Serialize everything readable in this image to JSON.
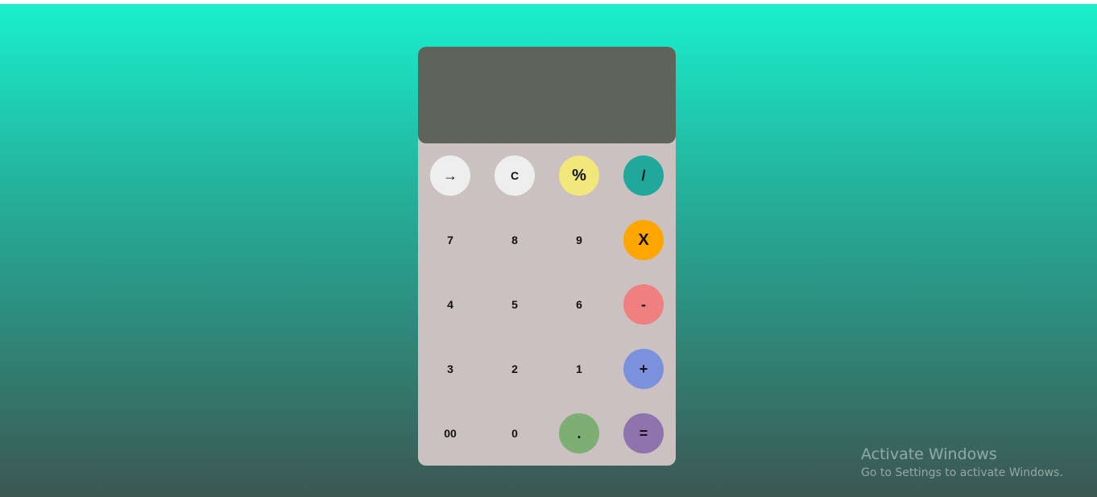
{
  "calculator": {
    "display_value": "",
    "colors": {
      "body": "#cbc1c1",
      "display": "#5e645c",
      "background_top": "#19f0cc",
      "background_bottom": "#3c5752"
    },
    "buttons": [
      {
        "label": "→",
        "name": "backspace-button",
        "color": "#eeeeee"
      },
      {
        "label": "C",
        "name": "clear-button",
        "color": "#eeeeee"
      },
      {
        "label": "%",
        "name": "percent-button",
        "color": "#f1e77b"
      },
      {
        "label": "/",
        "name": "divide-button",
        "color": "#20a89a"
      },
      {
        "label": "7",
        "name": "digit-7-button",
        "color": ""
      },
      {
        "label": "8",
        "name": "digit-8-button",
        "color": ""
      },
      {
        "label": "9",
        "name": "digit-9-button",
        "color": ""
      },
      {
        "label": "X",
        "name": "multiply-button",
        "color": "#ffa500"
      },
      {
        "label": "4",
        "name": "digit-4-button",
        "color": ""
      },
      {
        "label": "5",
        "name": "digit-5-button",
        "color": ""
      },
      {
        "label": "6",
        "name": "digit-6-button",
        "color": ""
      },
      {
        "label": "-",
        "name": "subtract-button",
        "color": "#f08080"
      },
      {
        "label": "3",
        "name": "digit-3-button",
        "color": ""
      },
      {
        "label": "2",
        "name": "digit-2-button",
        "color": ""
      },
      {
        "label": "1",
        "name": "digit-1-button",
        "color": ""
      },
      {
        "label": "+",
        "name": "add-button",
        "color": "#7b91de"
      },
      {
        "label": "00",
        "name": "double-zero-button",
        "color": ""
      },
      {
        "label": "0",
        "name": "digit-0-button",
        "color": ""
      },
      {
        "label": ".",
        "name": "decimal-button",
        "color": "#7dae74"
      },
      {
        "label": "=",
        "name": "equals-button",
        "color": "#8f73ad"
      }
    ]
  },
  "watermark": {
    "title": "Activate Windows",
    "subtitle": "Go to Settings to activate Windows."
  }
}
